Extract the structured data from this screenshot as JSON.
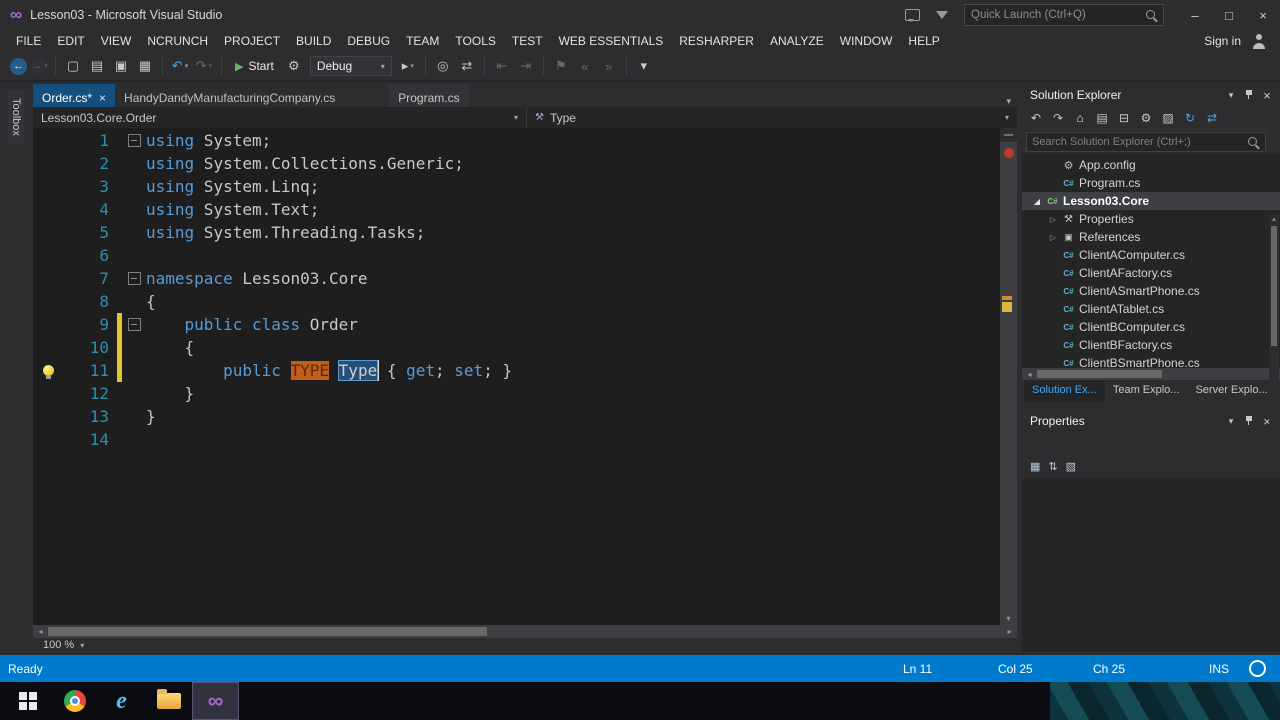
{
  "window": {
    "title": "Lesson03 - Microsoft Visual Studio",
    "quick_launch_placeholder": "Quick Launch (Ctrl+Q)",
    "controls": [
      "minimize",
      "maximize",
      "close"
    ]
  },
  "menu": {
    "items": [
      "FILE",
      "EDIT",
      "VIEW",
      "NCRUNCH",
      "PROJECT",
      "BUILD",
      "DEBUG",
      "TEAM",
      "TOOLS",
      "TEST",
      "WEB ESSENTIALS",
      "RESHARPER",
      "ANALYZE",
      "WINDOW",
      "HELP"
    ],
    "sign_in": "Sign in"
  },
  "toolbar": {
    "items": [
      {
        "name": "navigate-back"
      },
      {
        "name": "navigate-forward",
        "disabled": true,
        "dd": true
      },
      {
        "sep": true
      },
      {
        "name": "new-file"
      },
      {
        "name": "open-file"
      },
      {
        "name": "save"
      },
      {
        "name": "save-all"
      },
      {
        "sep": true
      },
      {
        "name": "undo",
        "accent": true,
        "dd": true
      },
      {
        "name": "redo",
        "disabled": true,
        "dd": true
      },
      {
        "sep": true
      },
      {
        "name": "start",
        "type": "button",
        "label": "Start"
      },
      {
        "name": "attach"
      },
      {
        "name": "debug-target",
        "type": "combo",
        "label": "Debug"
      },
      {
        "name": "run-dropdown",
        "dd": true
      },
      {
        "sep": true
      },
      {
        "name": "find-in-files"
      },
      {
        "name": "sync"
      },
      {
        "sep": true
      },
      {
        "name": "indent-decrease",
        "disabled": true
      },
      {
        "name": "indent-increase",
        "disabled": true
      },
      {
        "sep": true
      },
      {
        "name": "bookmark",
        "disabled": true
      },
      {
        "name": "comment",
        "disabled": true
      },
      {
        "name": "uncomment",
        "disabled": true
      },
      {
        "sep": true
      },
      {
        "name": "toolbar-options"
      }
    ]
  },
  "document_tabs": [
    {
      "label": "Order.cs*",
      "active": true
    },
    {
      "label": "HandyDandyManufacturingCompany.cs",
      "active": false
    },
    {
      "label": "Program.cs",
      "active": false,
      "preview": true
    }
  ],
  "breadcrumb": {
    "scope": "Lesson03.Core.Order",
    "member": "Type"
  },
  "toolbox_label": "Toolbox",
  "editor": {
    "zoom": "100 %",
    "lines": [
      {
        "n": 1,
        "fold": true,
        "seg": [
          [
            "using",
            "kw"
          ],
          [
            " System;",
            "pl"
          ]
        ]
      },
      {
        "n": 2,
        "seg": [
          [
            "using",
            "kw"
          ],
          [
            " System.Collections.Generic;",
            "pl"
          ]
        ]
      },
      {
        "n": 3,
        "seg": [
          [
            "using",
            "kw"
          ],
          [
            " System.Linq;",
            "pl"
          ]
        ]
      },
      {
        "n": 4,
        "seg": [
          [
            "using",
            "kw"
          ],
          [
            " System.Text;",
            "pl"
          ]
        ]
      },
      {
        "n": 5,
        "seg": [
          [
            "using",
            "kw"
          ],
          [
            " System.Threading.Tasks;",
            "pl"
          ]
        ]
      },
      {
        "n": 6,
        "seg": []
      },
      {
        "n": 7,
        "fold": true,
        "seg": [
          [
            "namespace",
            "kw"
          ],
          [
            " Lesson03.Core",
            "pl"
          ]
        ]
      },
      {
        "n": 8,
        "seg": [
          [
            "{",
            "pl"
          ]
        ]
      },
      {
        "n": 9,
        "fold": true,
        "mod": true,
        "seg": [
          [
            "    ",
            "pl"
          ],
          [
            "public",
            "kw"
          ],
          [
            " ",
            "pl"
          ],
          [
            "class",
            "kw"
          ],
          [
            " Order",
            "pl"
          ]
        ]
      },
      {
        "n": 10,
        "mod": true,
        "seg": [
          [
            "    {",
            "pl"
          ]
        ]
      },
      {
        "n": 11,
        "mod": true,
        "bulb": true,
        "seg": [
          [
            "        ",
            "pl"
          ],
          [
            "public",
            "kw"
          ],
          [
            " ",
            "pl"
          ],
          [
            "TYPE",
            "snippet"
          ],
          [
            " ",
            "pl"
          ],
          [
            "Type",
            "selected"
          ],
          [
            " { ",
            "pl"
          ],
          [
            "get",
            "kw"
          ],
          [
            "; ",
            "pl"
          ],
          [
            "set",
            "kw"
          ],
          [
            "; }",
            "pl"
          ]
        ]
      },
      {
        "n": 12,
        "seg": [
          [
            "    }",
            "pl"
          ]
        ]
      },
      {
        "n": 13,
        "seg": [
          [
            "}",
            "pl"
          ]
        ]
      },
      {
        "n": 14,
        "seg": []
      }
    ]
  },
  "solution_explorer": {
    "title": "Solution Explorer",
    "search_placeholder": "Search Solution Explorer (Ctrl+;)",
    "toolbar_icons": [
      "undo-navigation",
      "redo-navigation",
      "home",
      "show-all-files",
      "collapse-all",
      "properties-window",
      "preview-selected",
      "refresh",
      "sync-with-active"
    ],
    "tree": [
      {
        "label": "App.config",
        "icon": "config-file",
        "indent": 2
      },
      {
        "label": "Program.cs",
        "icon": "csharp-file",
        "indent": 2
      },
      {
        "label": "Lesson03.Core",
        "icon": "csharp-project",
        "indent": 1,
        "selected": true,
        "bold": true,
        "state": "expanded"
      },
      {
        "label": "Properties",
        "icon": "properties-folder",
        "indent": 2,
        "state": "collapsed"
      },
      {
        "label": "References",
        "icon": "references",
        "indent": 2,
        "state": "collapsed"
      },
      {
        "label": "ClientAComputer.cs",
        "icon": "csharp-file",
        "indent": 2
      },
      {
        "label": "ClientAFactory.cs",
        "icon": "csharp-file",
        "indent": 2
      },
      {
        "label": "ClientASmartPhone.cs",
        "icon": "csharp-file",
        "indent": 2
      },
      {
        "label": "ClientATablet.cs",
        "icon": "csharp-file",
        "indent": 2
      },
      {
        "label": "ClientBComputer.cs",
        "icon": "csharp-file",
        "indent": 2
      },
      {
        "label": "ClientBFactory.cs",
        "icon": "csharp-file",
        "indent": 2
      },
      {
        "label": "ClientBSmartPhone.cs",
        "icon": "csharp-file",
        "indent": 2
      }
    ],
    "bottom_tabs": [
      {
        "label": "Solution Ex...",
        "active": true
      },
      {
        "label": "Team Explo...",
        "active": false
      },
      {
        "label": "Server Explo...",
        "active": false
      }
    ]
  },
  "properties": {
    "title": "Properties",
    "toolbar_icons": [
      "categorized",
      "alphabetical",
      "property-pages"
    ]
  },
  "status": {
    "ready": "Ready",
    "line": "Ln 11",
    "column": "Col 25",
    "character": "Ch 25",
    "mode": "INS"
  },
  "taskbar": {
    "icons": [
      "start",
      "chrome",
      "internet-explorer",
      "file-explorer",
      "visual-studio"
    ],
    "active": "visual-studio"
  },
  "colors": {
    "accent": "#007acc",
    "status_bar": "#007acc",
    "editor_background": "#1e1e1e",
    "keyword": "#569cd6",
    "line_number": "#2b91af",
    "snippet_field": "#c25d1e",
    "selection": "#264f78",
    "modified_line": "#e0c52e",
    "active_tab": "#14507e"
  }
}
